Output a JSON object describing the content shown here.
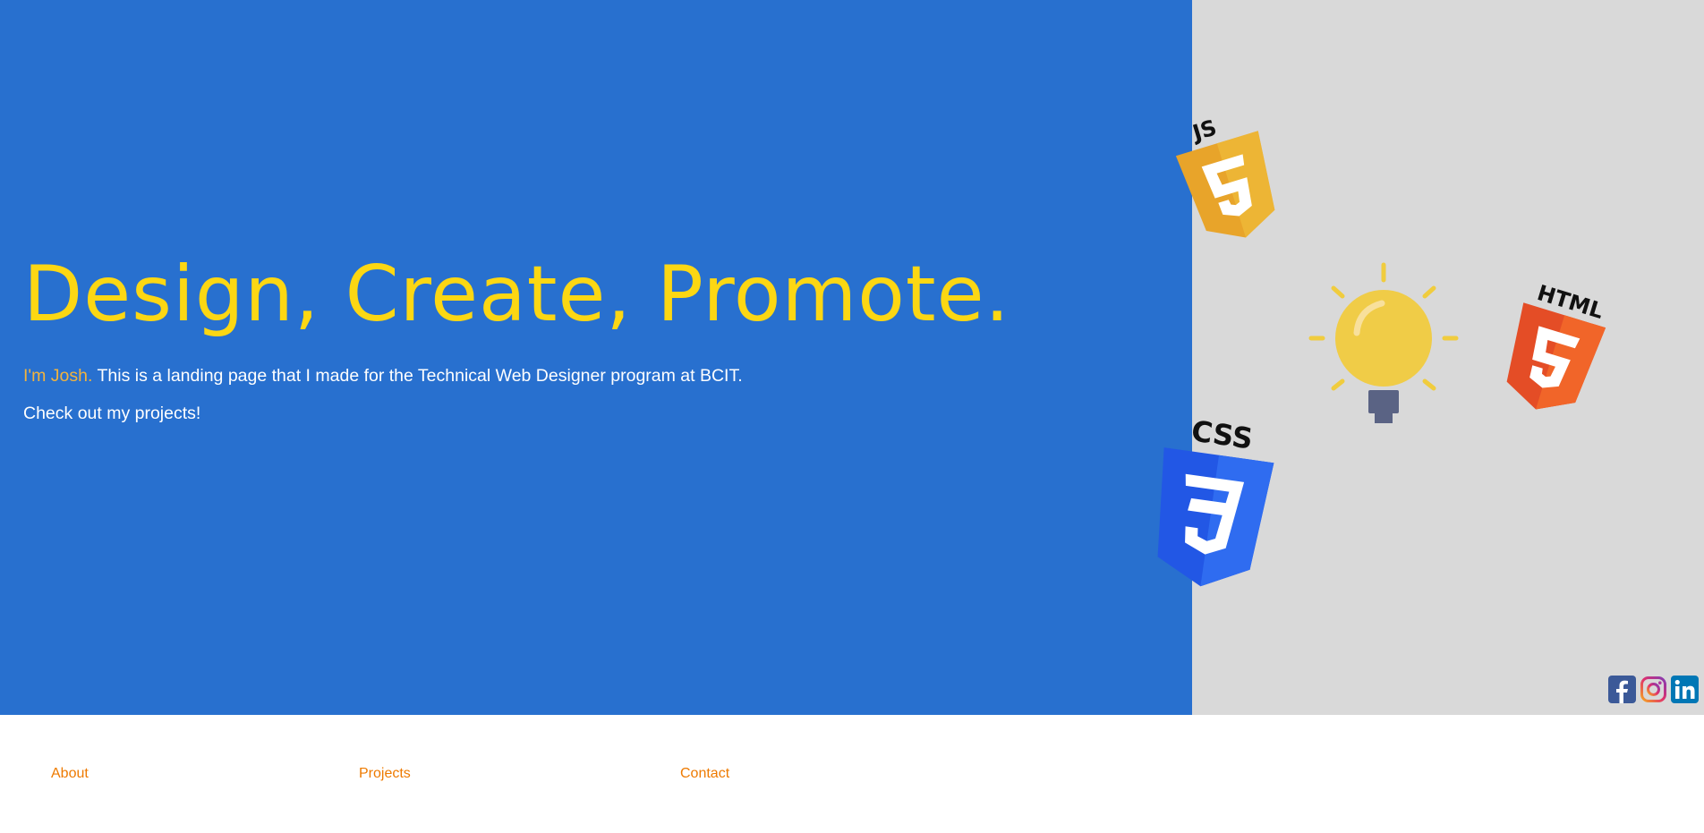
{
  "hero": {
    "headline": "Design, Create, Promote.",
    "intro_name": "I'm Josh.",
    "intro_text": " This is a landing page that I made for the Technical Web Designer program at BCIT.",
    "cta": "Check out my projects!"
  },
  "illustration": {
    "js_label": "JS",
    "css_label": "CSS",
    "html_label": "HTML",
    "icons": [
      "js-shield-icon",
      "css-shield-icon",
      "html-shield-icon",
      "lightbulb-icon"
    ]
  },
  "social": {
    "icons": [
      "facebook-icon",
      "instagram-icon",
      "linkedin-icon"
    ]
  },
  "nav": {
    "about": "About",
    "projects": "Projects",
    "contact": "Contact"
  },
  "colors": {
    "hero_blue": "#2870cf",
    "panel_gray": "#d9d9d9",
    "headline_yellow": "#fcd713",
    "name_orange": "#f2b33d",
    "nav_orange": "#ee7a00"
  }
}
